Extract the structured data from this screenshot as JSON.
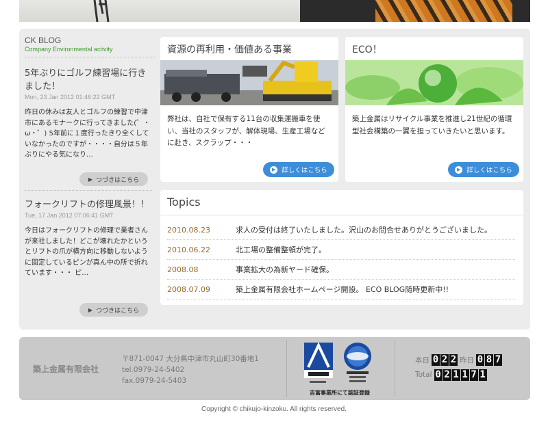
{
  "blog": {
    "title": "CK BLOG",
    "subtitle": "Company Environmental activity",
    "posts": [
      {
        "title": "5年ぶりにゴルフ練習場に行きました！",
        "date": "Mon, 23 Jan 2012 01:46:22 GMT",
        "body": "昨日の休みは友人とゴルフの練習で中津市にあるモナークに行ってきました(゜・ω・゜) 5年前に１度行ったきり全くしていなかったのですが・・・・自分は５年ぶりにやる気になり…",
        "more": "つづきはこちら"
      },
      {
        "title": "フォークリフトの修理風景！！",
        "date": "Tue, 17 Jan 2012 07:06:41 GMT",
        "body": "今日はフォークリフトの修理で業者さんが来社しました！どこが壊れたかというとリフトの爪が横方向に移動しないように固定しているピンが真ん中の所で折れています・・・ ピ…",
        "more": "つづきはこちら"
      }
    ]
  },
  "cards": [
    {
      "title": "資源の再利用・価値ある事業",
      "text": "弊社は、自社で保有する11台の収集運搬車を使い、当社のスタッフが、解体現場、生産工場などに赴き、スクラップ・・・",
      "button": "詳しくはこちら"
    },
    {
      "title": "ECO！",
      "text": "築上金属はリサイクル事業を推進し21世紀の循環型社会構築の一翼を担っていきたいと思います。",
      "button": "詳しくはこちら"
    }
  ],
  "topics": {
    "title": "Topics",
    "items": [
      {
        "date": "2010.08.23",
        "text": "求人の受付は終了いたしました。沢山のお問合せありがとうございました。"
      },
      {
        "date": "2010.06.22",
        "text": "北工場の整備整頓が完了。"
      },
      {
        "date": "2008.08",
        "text": "事業拡大の為新ヤード確保。"
      },
      {
        "date": "2008.07.09",
        "text": "築上金属有限会社ホームページ開設。 ECO BLOG随時更新中!!"
      }
    ]
  },
  "footer": {
    "company": "築上金属有限会社",
    "address": "〒871-0047 大分県中津市丸山町30番地1",
    "tel": "tel.0979-24-5402",
    "fax": "fax.0979-24-5403",
    "cert_caption": "吉富事業所にて認証登録",
    "counter": {
      "today_label": "本日",
      "today": "022",
      "yesterday_label": "昨日",
      "yesterday": "087",
      "total_label": "Total",
      "total": "021171"
    }
  },
  "copyright": "Copyright © chikujo-kinzoku. All rights reserved.",
  "colors": {
    "accent_blue": "#3d8ed9",
    "green": "#3a9a2a",
    "topic_date": "#9a6a2a"
  }
}
